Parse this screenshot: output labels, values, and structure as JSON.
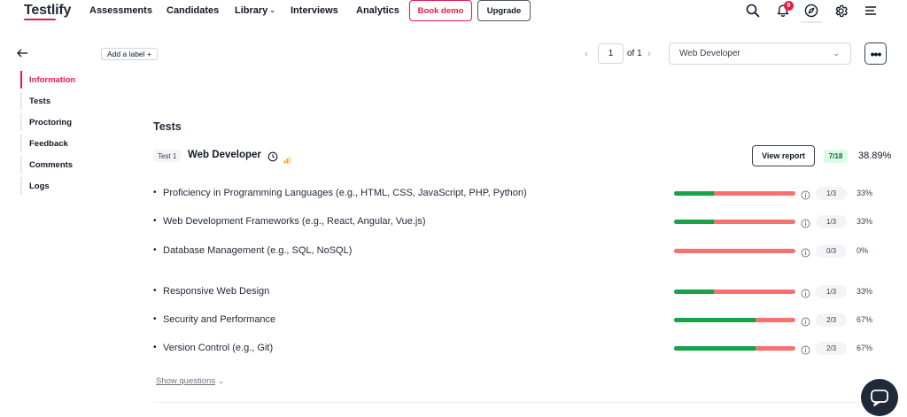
{
  "nav": {
    "logo": "Testlify",
    "items": [
      {
        "label": "Assessments"
      },
      {
        "label": "Candidates"
      },
      {
        "label": "Library"
      },
      {
        "label": "Interviews"
      },
      {
        "label": "Analytics"
      }
    ],
    "book_demo": "Book demo",
    "upgrade": "Upgrade",
    "notification_count": "9",
    "icons": [
      "search-icon",
      "bell-icon",
      "compass-icon",
      "gear-icon",
      "menu-icon"
    ]
  },
  "sidebar": {
    "items": [
      {
        "label": "Information",
        "active": true
      },
      {
        "label": "Tests"
      },
      {
        "label": "Proctoring"
      },
      {
        "label": "Feedback"
      },
      {
        "label": "Comments"
      },
      {
        "label": "Logs"
      }
    ]
  },
  "toolbar": {
    "add_label": "Add a label +",
    "page_current": "1",
    "page_of": "of 1",
    "assessment_select": "Web Developer"
  },
  "tests": {
    "title": "Tests",
    "test_tag": "Test 1",
    "test_name": "Web Developer",
    "view_report": "View report",
    "score_badge": "7/18",
    "score_pct": "38.89%",
    "skills": [
      {
        "name": "Proficiency in Programming Languages (e.g., HTML, CSS, JavaScript, PHP, Python)",
        "fraction": "1/3",
        "pct": "33%",
        "progress": 0.33
      },
      {
        "name": "Web Development Frameworks (e.g., React, Angular, Vue.js)",
        "fraction": "1/3",
        "pct": "33%",
        "progress": 0.33
      },
      {
        "name": "Database Management (e.g., SQL, NoSQL)",
        "fraction": "0/3",
        "pct": "0%",
        "progress": 0
      },
      {
        "name": "Responsive Web Design",
        "fraction": "1/3",
        "pct": "33%",
        "progress": 0.33
      },
      {
        "name": "Security and Performance",
        "fraction": "2/3",
        "pct": "67%",
        "progress": 0.67
      },
      {
        "name": "Version Control (e.g., Git)",
        "fraction": "2/3",
        "pct": "67%",
        "progress": 0.67
      }
    ],
    "show_questions": "Show questions"
  },
  "colors": {
    "brand": "#e11d48",
    "bar_pass": "#16a34a",
    "bar_fail": "#f87171",
    "score_badge_bg": "#dcfce7"
  }
}
